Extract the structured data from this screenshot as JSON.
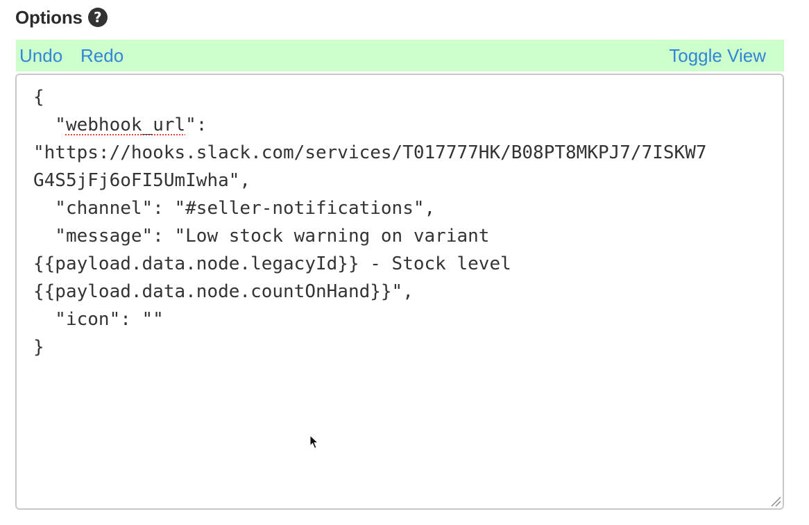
{
  "options": {
    "title": "Options",
    "help_icon": "question-circle-icon",
    "help_glyph": "?"
  },
  "toolbar": {
    "undo_label": "Undo",
    "redo_label": "Redo",
    "toggle_view_label": "Toggle View",
    "background_color": "#ccffcc",
    "link_color": "#3385d6"
  },
  "editor": {
    "lines": [
      "{",
      "  \"",
      "\":",
      "\"https://hooks.slack.com/services/T017777HK/B08PT8MKPJ7/7ISKW7",
      "G4S5jFj6oFI5UmIwha\",",
      "  \"channel\": \"#seller-notifications\",",
      "  \"message\": \"Low stock warning on variant",
      "{{payload.data.node.legacyId}} - Stock level",
      "{{payload.data.node.countOnHand}}\",",
      "  \"icon\": \"\"",
      "}"
    ],
    "misspelled_word": "webhook_url"
  }
}
